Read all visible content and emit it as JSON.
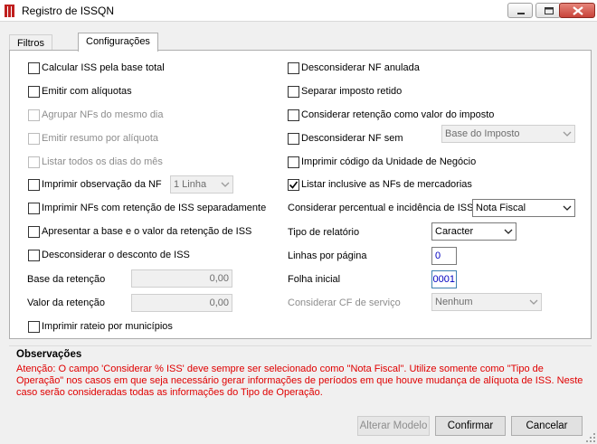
{
  "window": {
    "title": "Registro de ISSQN"
  },
  "tabs": [
    {
      "label": "Filtros"
    },
    {
      "label": "Configurações"
    }
  ],
  "left": {
    "calc_base_total": "Calcular ISS pela base total",
    "emitir_aliquotas": "Emitir com alíquotas",
    "agrupar_nfs": "Agrupar NFs do mesmo dia",
    "emitir_resumo": "Emitir resumo por alíquota",
    "listar_dias": "Listar todos os dias do mês",
    "imprimir_obs": "Imprimir observação da NF",
    "imprimir_obs_combo": "1 Linha",
    "imprimir_retencao": "Imprimir NFs com retenção de ISS separadamente",
    "apresentar_base": "Apresentar a base e o valor da retenção de ISS",
    "desconsiderar_desconto": "Desconsiderar o desconto de ISS",
    "base_retencao_label": "Base da retenção",
    "base_retencao_value": "0,00",
    "valor_retencao_label": "Valor da retenção",
    "valor_retencao_value": "0,00",
    "imprimir_rateio": "Imprimir rateio por municípios"
  },
  "right": {
    "desc_nf_anulada": "Desconsiderar NF anulada",
    "separar_imposto": "Separar imposto retido",
    "considerar_retencao": "Considerar retenção como valor do imposto",
    "desc_nf_sem": "Desconsiderar NF sem",
    "desc_nf_sem_combo": "Base do Imposto",
    "imprimir_codigo": "Imprimir código da Unidade de Negócio",
    "listar_mercadorias": "Listar inclusive as NFs de mercadorias",
    "considerar_percentual_label": "Considerar percentual e incidência de ISS",
    "considerar_percentual_combo": "Nota Fiscal",
    "tipo_relatorio_label": "Tipo de relatório",
    "tipo_relatorio_combo": "Caracter",
    "linhas_pagina_label": "Linhas por página",
    "linhas_pagina_value": "0",
    "folha_inicial_label": "Folha inicial",
    "folha_inicial_value": "0001",
    "considerar_cf_label": "Considerar CF de serviço",
    "considerar_cf_combo": "Nenhum"
  },
  "observacoes": {
    "title": "Observações",
    "text": "Atenção: O campo 'Considerar % ISS' deve sempre ser selecionado como \"Nota Fiscal\". Utilize somente como \"Tipo de Operação\" nos casos em que seja necessário gerar informações de períodos em que houve mudança de alíquota de ISS. Neste caso serão consideradas todas as informações do Tipo de Operação."
  },
  "buttons": {
    "alterar_modelo": "Alterar Modelo",
    "confirmar": "Confirmar",
    "cancelar": "Cancelar"
  },
  "checked": {
    "listar_mercadorias": true
  },
  "colors": {
    "warning_text": "#e00000",
    "field_text": "#0000c0",
    "close_button": "#c8433a"
  }
}
